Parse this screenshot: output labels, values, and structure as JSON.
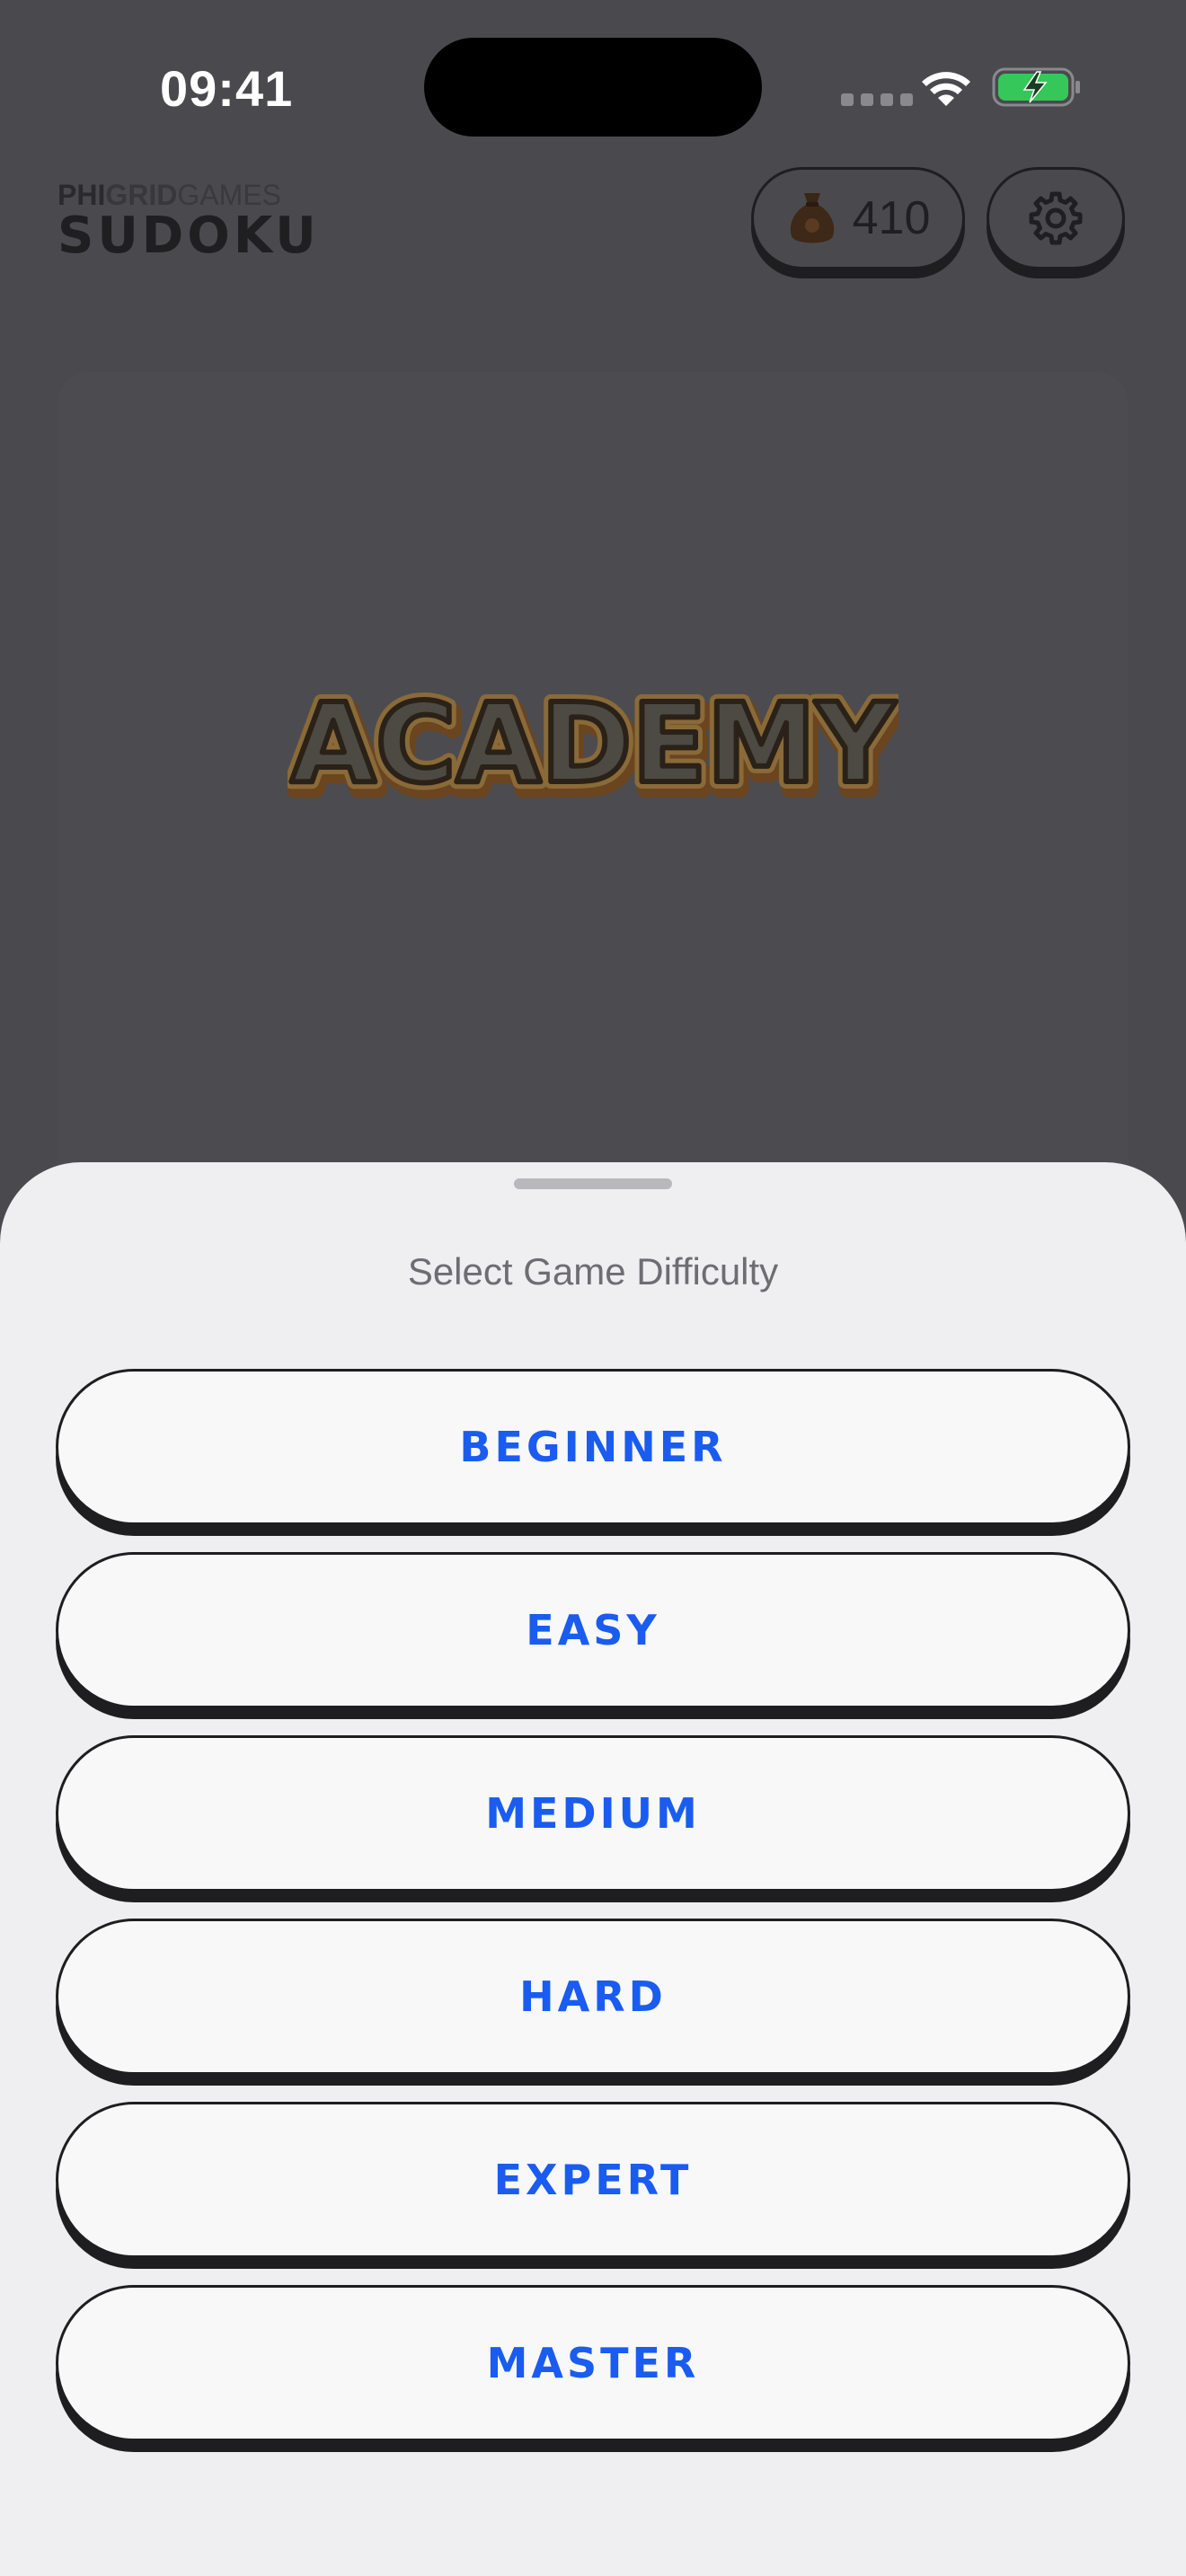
{
  "status_bar": {
    "time": "09:41"
  },
  "header": {
    "brand_part1": "PHI",
    "brand_part2": "GRID",
    "brand_part3": "GAMES",
    "title": "SUDOKU",
    "coins": "410",
    "coin_icon": "money-bag-icon",
    "settings_icon": "gear-icon"
  },
  "hero": {
    "logo_text": "ACADEMY"
  },
  "sheet": {
    "title": "Select Game Difficulty",
    "options": [
      {
        "label": "BEGINNER"
      },
      {
        "label": "EASY"
      },
      {
        "label": "MEDIUM"
      },
      {
        "label": "HARD"
      },
      {
        "label": "EXPERT"
      },
      {
        "label": "MASTER"
      }
    ]
  },
  "colors": {
    "accent": "#1a5cf0",
    "overlay": "#4a4a4e",
    "sheet_bg": "#efeff1",
    "battery_green": "#35c759"
  }
}
